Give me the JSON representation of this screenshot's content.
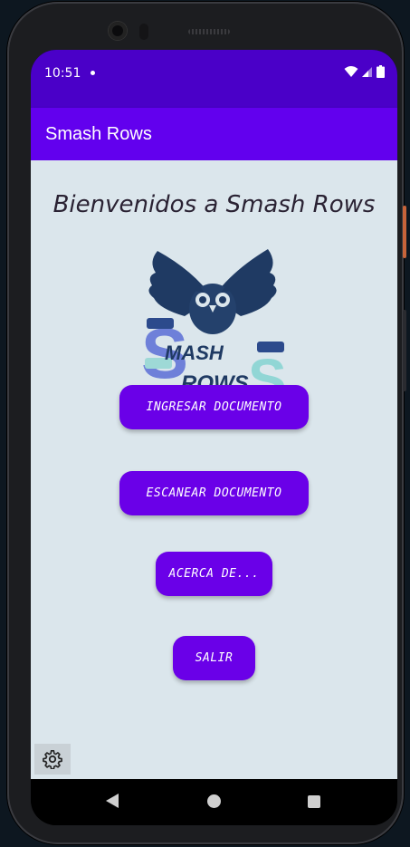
{
  "status": {
    "time": "10:51"
  },
  "app": {
    "title": "Smash Rows"
  },
  "main": {
    "welcome": "Bienvenidos a Smash Rows",
    "logo_text_top": "MASH",
    "logo_text_bottom": "ROWS",
    "buttons": {
      "ingresar": "INGRESAR DOCUMENTO",
      "escanear": "ESCANEAR DOCUMENTO",
      "acerca": "ACERCA DE...",
      "salir": "SALIR"
    }
  },
  "icons": {
    "settings": "gear-icon",
    "back": "nav-back-icon",
    "home": "nav-home-icon",
    "recents": "nav-recents-icon"
  },
  "colors": {
    "statusbar": "#4a00c8",
    "appbar": "#6200ee",
    "button": "#6a00e8",
    "background": "#dbe6ec"
  }
}
